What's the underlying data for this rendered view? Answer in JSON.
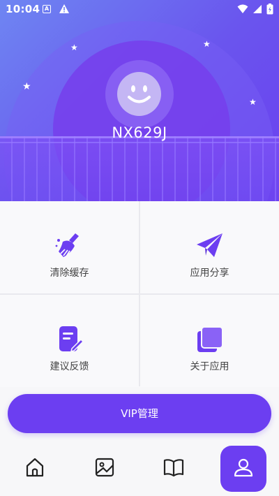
{
  "status_bar": {
    "time": "10:04",
    "icon_a": "A"
  },
  "profile": {
    "device_name": "NX629J"
  },
  "menu": [
    {
      "label": "清除缓存",
      "icon": "broom-icon"
    },
    {
      "label": "应用分享",
      "icon": "paper-plane-icon"
    },
    {
      "label": "建议反馈",
      "icon": "edit-document-icon"
    },
    {
      "label": "关于应用",
      "icon": "copy-stack-icon"
    }
  ],
  "vip_button": {
    "label": "VIP管理"
  },
  "bottom_nav": [
    {
      "icon": "home-icon",
      "active": false
    },
    {
      "icon": "gallery-icon",
      "active": false
    },
    {
      "icon": "book-icon",
      "active": false
    },
    {
      "icon": "user-icon",
      "active": true
    }
  ],
  "colors": {
    "accent": "#6c3ef1",
    "header_start": "#6e86f2",
    "header_end": "#6a3ff0"
  }
}
